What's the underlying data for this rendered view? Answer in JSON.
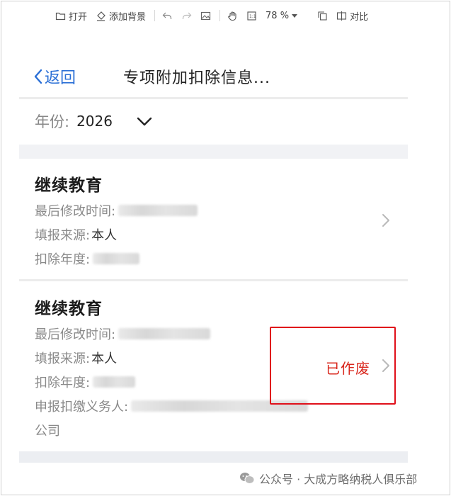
{
  "toolbar": {
    "open": "打开",
    "add_background": "添加背景",
    "zoom": "78 %",
    "compare": "对比"
  },
  "nav": {
    "back": "返回",
    "title": "专项附加扣除信息..."
  },
  "year": {
    "label": "年份:",
    "value": "2026"
  },
  "records": [
    {
      "title": "继续教育",
      "modified_label": "最后修改时间:",
      "source_label": "填报来源:",
      "source_value": "本人",
      "year_label": "扣除年度:"
    },
    {
      "title": "继续教育",
      "modified_label": "最后修改时间:",
      "source_label": "填报来源:",
      "source_value": "本人",
      "year_label": "扣除年度:",
      "withholding_label": "申报扣缴义务人:",
      "withholding_suffix": "公司",
      "status": "已作废"
    }
  ],
  "watermark": "公众号 · 大成方略纳税人俱乐部",
  "colors": {
    "accent_blue": "#2a6fd6",
    "status_red": "#d9281e",
    "highlight_red": "#e0101a"
  }
}
